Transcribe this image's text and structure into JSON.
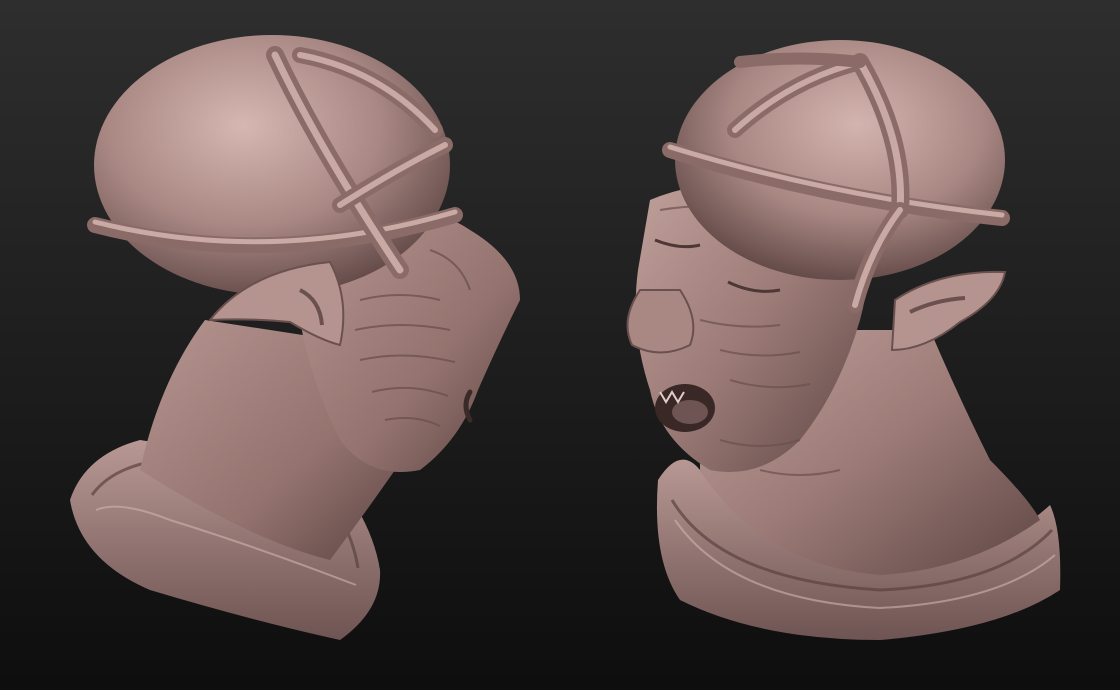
{
  "scene": {
    "background_top": "#2e2e2e",
    "background_bottom": "#0e0e0e",
    "clay_light": "#c8a8a2",
    "clay_mid": "#a48480",
    "clay_dark": "#5a4240",
    "models": [
      {
        "id": "left-bust",
        "view": "side-profile",
        "facing": "right"
      },
      {
        "id": "right-bust",
        "view": "three-quarter-front",
        "facing": "left"
      }
    ]
  }
}
